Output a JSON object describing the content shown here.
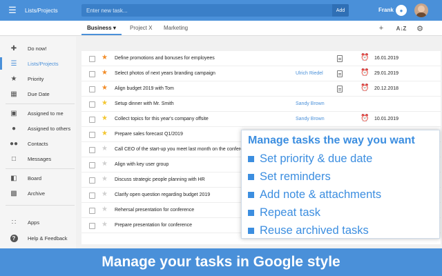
{
  "topbar": {
    "app_title": "Lists/Projects",
    "search_placeholder": "Enter new task...",
    "add_label": "Add",
    "user_name": "Frank"
  },
  "tabs": [
    {
      "label": "Business",
      "active": true
    },
    {
      "label": "Project X",
      "active": false
    },
    {
      "label": "Marketing",
      "active": false
    }
  ],
  "sidebar": {
    "items": [
      {
        "label": "Do now!",
        "icon": "gamepad-icon"
      },
      {
        "label": "Lists/Projects",
        "icon": "list-icon",
        "active": true
      },
      {
        "label": "Priority",
        "icon": "star-icon"
      },
      {
        "label": "Due Date",
        "icon": "calendar-icon"
      },
      {
        "label": "Assigned to me",
        "icon": "inbox-icon"
      },
      {
        "label": "Assigned to others",
        "icon": "person-icon"
      },
      {
        "label": "Contacts",
        "icon": "people-icon"
      },
      {
        "label": "Messages",
        "icon": "message-icon"
      },
      {
        "label": "Board",
        "icon": "board-icon"
      },
      {
        "label": "Archive",
        "icon": "archive-icon"
      },
      {
        "label": "Apps",
        "icon": "apps-grid-icon"
      },
      {
        "label": "Help & Feedback",
        "icon": "help-icon"
      }
    ]
  },
  "tasks": [
    {
      "title": "Define promotions and bonuses for employees",
      "star": "orange",
      "assignee": "",
      "note": true,
      "alarm": true,
      "date": "16.01.2019"
    },
    {
      "title": "Select photos of next years branding campaign",
      "star": "orange",
      "assignee": "Ulrich Riedel",
      "note": true,
      "alarm": true,
      "date": "29.01.2019"
    },
    {
      "title": "Align budget 2019 with Tom",
      "star": "orange",
      "assignee": "",
      "note": true,
      "alarm": true,
      "date": "20.12.2018"
    },
    {
      "title": "Setup dinner with Mr. Smith",
      "star": "yellow",
      "assignee": "Sandy Brown",
      "note": false,
      "alarm": false,
      "date": ""
    },
    {
      "title": "Collect topics for this year's company offsite",
      "star": "yellow",
      "assignee": "Sandy Brown",
      "note": false,
      "alarm": true,
      "date": "10.01.2019"
    },
    {
      "title": "Prepare sales forecast Q1/2019",
      "star": "yellow",
      "assignee": "",
      "note": false,
      "alarm": false,
      "date": ""
    },
    {
      "title": "Call CEO of the start-up you meet last month on the conference",
      "star": "grey",
      "assignee": "",
      "note": false,
      "alarm": false,
      "date": ""
    },
    {
      "title": "Align with key user group",
      "star": "grey",
      "assignee": "",
      "note": false,
      "alarm": false,
      "date": ""
    },
    {
      "title": "Discuss strategic people planning with HR",
      "star": "grey",
      "assignee": "",
      "note": false,
      "alarm": false,
      "date": ""
    },
    {
      "title": "Clarify open question regarding budget 2019",
      "star": "grey",
      "assignee": "",
      "note": false,
      "alarm": false,
      "date": ""
    },
    {
      "title": "Rehersal presentation for conference",
      "star": "grey",
      "assignee": "",
      "note": false,
      "alarm": false,
      "date": ""
    },
    {
      "title": "Prepare presentation for conference",
      "star": "grey",
      "assignee": "",
      "note": false,
      "alarm": false,
      "date": ""
    }
  ],
  "promo": {
    "title": "Manage tasks the way you want",
    "items": [
      "Set priority & due date",
      "Set reminders",
      "Add note & attachments",
      "Repeat task",
      "Reuse archived tasks"
    ]
  },
  "banner": {
    "text": "Manage your tasks in Google style"
  },
  "colors": {
    "primary": "#4a90d9",
    "promo": "#3c8ee0",
    "star_orange": "#f28c28",
    "star_yellow": "#f3c631"
  }
}
